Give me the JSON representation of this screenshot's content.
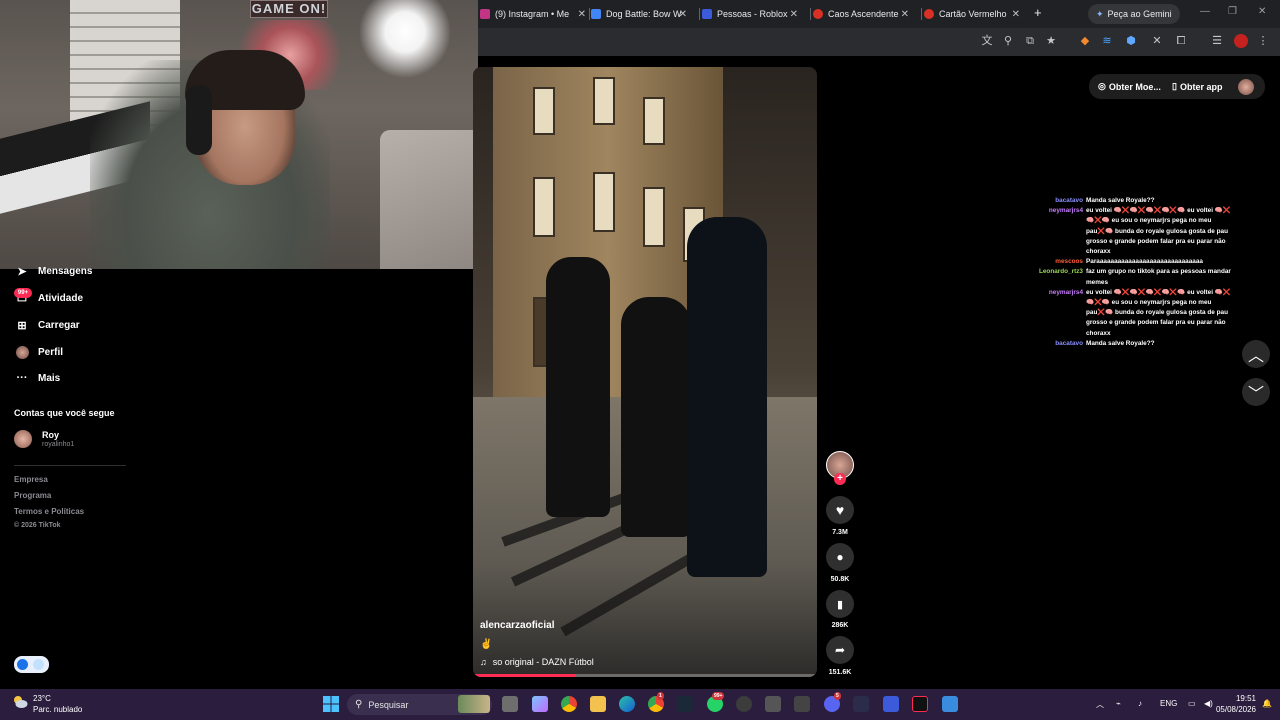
{
  "browser": {
    "tabs": [
      {
        "label": "(9) Instagram • Me",
        "icon": "instagram-icon",
        "color": "#c13584"
      },
      {
        "label": "Dog Battle: Bow W",
        "icon": "play-icon",
        "color": "#4285f4"
      },
      {
        "label": "Pessoas - Roblox",
        "icon": "roblox-icon",
        "color": "#3b5bdb"
      },
      {
        "label": "Caos Ascendente",
        "icon": "ctrlc-icon",
        "color": "#d93025"
      },
      {
        "label": "Cartão Vermelho",
        "icon": "ctrlc-icon",
        "color": "#d93025"
      }
    ],
    "new_tab": "+",
    "gemini_label": "Peça ao Gemini",
    "win_min": "—",
    "win_max": "❐",
    "win_close": "✕"
  },
  "sidebar": {
    "items": [
      {
        "label": "Mensagens",
        "icon": "paper-plane-icon"
      },
      {
        "label": "Atividade",
        "icon": "inbox-icon",
        "badge": "99+"
      },
      {
        "label": "Carregar",
        "icon": "plus-square-icon"
      },
      {
        "label": "Perfil",
        "icon": "profile-icon"
      },
      {
        "label": "Mais",
        "icon": "more-icon"
      }
    ],
    "following_title": "Contas que você segue",
    "following": {
      "name": "Roy",
      "handle": "royalinho1"
    },
    "footer": [
      "Empresa",
      "Programa",
      "Termos e Políticas"
    ],
    "copyright": "© 2026 TikTok"
  },
  "webcam": {
    "sign": "GAME ON!"
  },
  "video": {
    "author": "alencarzaoficial",
    "caption_emoji": "✌",
    "music": "so original - DAZN Fútbol",
    "progress": 0.3
  },
  "actions": {
    "likes": "7.3M",
    "comments": "50.8K",
    "saves": "286K",
    "shares": "151.6K"
  },
  "header": {
    "coins_label": "Obter Moe...",
    "app_label": "Obter app"
  },
  "chat": [
    {
      "user": "bacatavo",
      "color": "#8a8fff",
      "msg": "Manda salve Royale??"
    },
    {
      "user": "neymarjrs4",
      "color": "#c77dff",
      "msg": "eu voltei 🧠❌🧠❌🧠❌🧠❌🧠 eu voltei 🧠❌🧠❌🧠 eu sou o neymarjrs pega no meu pau❌🧠 bunda do royale gulosa gosta de pau grosso e grande podem falar pra eu parar não choraxx"
    },
    {
      "user": "mescoos",
      "color": "#ff5e3a",
      "msg": "Paraaaaaaaaaaaaaaaaaaaaaaaaaaaaaa"
    },
    {
      "user": "Leonardo_rtz3",
      "color": "#9bd35a",
      "msg": "faz um grupo no tiktok para as pessoas mandar memes"
    },
    {
      "user": "neymarjrs4",
      "color": "#c77dff",
      "msg": "eu voltei 🧠❌🧠❌🧠❌🧠❌🧠 eu voltei 🧠❌🧠❌🧠 eu sou o neymarjrs pega no meu pau❌🧠 bunda do royale gulosa gosta de pau grosso e grande podem falar pra eu parar não choraxx"
    },
    {
      "user": "bacatavo",
      "color": "#8a8fff",
      "msg": "Manda salve Royale??"
    }
  ],
  "taskbar": {
    "weather_temp": "23°C",
    "weather_desc": "Parc. nublado",
    "search_placeholder": "Pesquisar",
    "badges": {
      "whatsapp": "99+",
      "chrome": "1",
      "discord": "5"
    },
    "lang": "ENG",
    "time": "19:51",
    "date": "05/08/2026"
  }
}
